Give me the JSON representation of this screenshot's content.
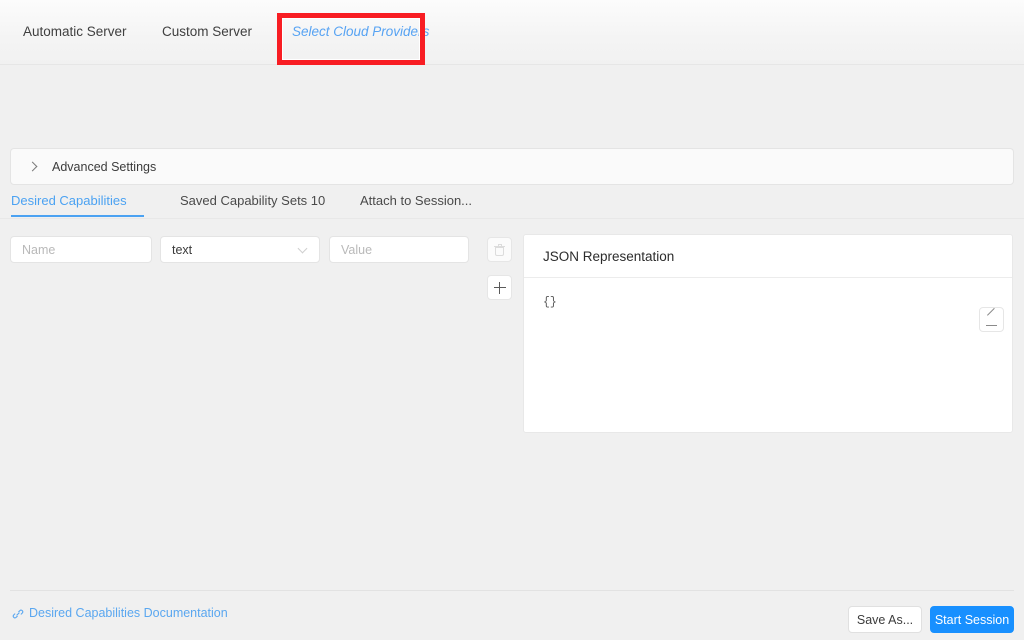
{
  "server_tabs": [
    {
      "label": "Automatic Server",
      "active": false,
      "highlighted": false
    },
    {
      "label": "Custom Server",
      "active": false,
      "highlighted": false
    },
    {
      "label": "Select Cloud Providers",
      "active": false,
      "highlighted": true
    }
  ],
  "advanced": {
    "title": "Advanced Settings",
    "expand_icon": "chevron-right-icon",
    "expanded": false
  },
  "capability_tabs": [
    {
      "label": "Desired Capabilities",
      "active": true
    },
    {
      "label": "Saved Capability Sets 10",
      "active": false
    },
    {
      "label": "Attach to Session...",
      "active": false
    }
  ],
  "capability_row": {
    "name_placeholder": "Name",
    "name_value": "",
    "type_value": "text",
    "type_icon": "chevron-down-icon",
    "value_placeholder": "Value",
    "value_value": "",
    "delete_icon": "trash-icon",
    "add_icon": "plus-icon"
  },
  "json_panel": {
    "title": "JSON Representation",
    "content": "{}",
    "edit_icon": "pencil-icon"
  },
  "footer": {
    "doc_link_label": "Desired Capabilities Documentation",
    "doc_link_icon": "link-icon",
    "save_as_label": "Save As...",
    "start_session_label": "Start Session"
  },
  "colors": {
    "accent_blue": "#1890ff",
    "tab_blue": "#4ba2f2",
    "highlight_red": "#f81d23",
    "page_background": "#f0f0f0",
    "card_background": "#ffffff"
  }
}
